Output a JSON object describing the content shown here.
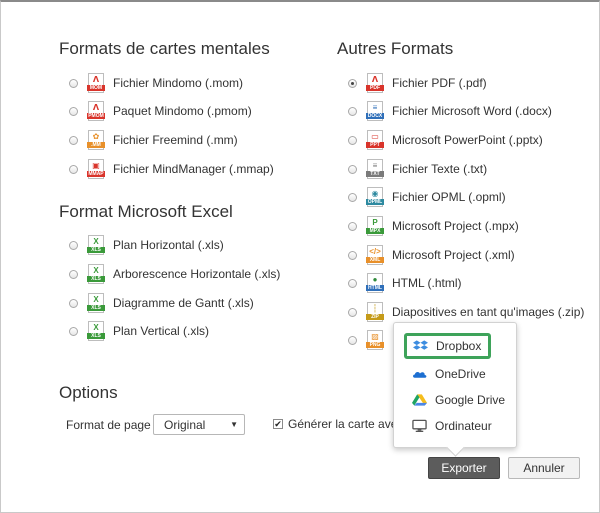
{
  "mind_map_formats": {
    "title": "Formats de cartes mentales",
    "items": [
      {
        "label": "Fichier Mindomo (.mom)",
        "tag": "MOM",
        "icon": "mindomo-file-icon"
      },
      {
        "label": "Paquet Mindomo (.pmom)",
        "tag": "PMOM",
        "icon": "mindomo-package-icon"
      },
      {
        "label": "Fichier Freemind (.mm)",
        "tag": ".MM",
        "icon": "freemind-file-icon"
      },
      {
        "label": "Fichier MindManager (.mmap)",
        "tag": "MMAP",
        "icon": "mindmanager-file-icon"
      }
    ]
  },
  "excel_formats": {
    "title": "Format Microsoft Excel",
    "items": [
      {
        "label": "Plan Horizontal (.xls)",
        "tag": "XLS",
        "icon": "excel-file-icon"
      },
      {
        "label": "Arborescence Horizontale (.xls)",
        "tag": "XLS",
        "icon": "excel-file-icon"
      },
      {
        "label": "Diagramme de Gantt (.xls)",
        "tag": "XLS",
        "icon": "excel-file-icon"
      },
      {
        "label": "Plan Vertical (.xls)",
        "tag": "XLS",
        "icon": "excel-file-icon"
      }
    ]
  },
  "other_formats": {
    "title": "Autres Formats",
    "selected_index": 0,
    "items": [
      {
        "label": "Fichier PDF (.pdf)",
        "tag": "PDF",
        "icon": "pdf-file-icon"
      },
      {
        "label": "Fichier Microsoft Word (.docx)",
        "tag": "DOCX",
        "icon": "word-file-icon"
      },
      {
        "label": "Microsoft PowerPoint (.pptx)",
        "tag": "PPT",
        "icon": "powerpoint-file-icon"
      },
      {
        "label": "Fichier Texte (.txt)",
        "tag": "TXT",
        "icon": "text-file-icon"
      },
      {
        "label": "Fichier OPML (.opml)",
        "tag": "OPML",
        "icon": "opml-file-icon"
      },
      {
        "label": "Microsoft Project (.mpx)",
        "tag": "MPX",
        "icon": "project-file-icon"
      },
      {
        "label": "Microsoft Project (.xml)",
        "tag": "XML",
        "icon": "xml-file-icon"
      },
      {
        "label": "HTML (.html)",
        "tag": "HTML",
        "icon": "html-file-icon"
      },
      {
        "label": "Diapositives en tant qu'images (.zip)",
        "tag": "ZIP",
        "icon": "zip-file-icon"
      },
      {
        "label": "",
        "tag": "PNG",
        "icon": "png-file-icon"
      }
    ]
  },
  "options": {
    "title": "Options",
    "page_format_label": "Format de page",
    "page_format_value": "Original",
    "generate_label": "Générer la carte avec",
    "generate_checked": true
  },
  "export_menu": {
    "items": [
      {
        "label": "Dropbox",
        "icon": "dropbox-icon"
      },
      {
        "label": "OneDrive",
        "icon": "onedrive-icon"
      },
      {
        "label": "Google Drive",
        "icon": "google-drive-icon"
      },
      {
        "label": "Ordinateur",
        "icon": "computer-icon"
      }
    ],
    "highlight_color": "#3ea35a"
  },
  "buttons": {
    "export": "Exporter",
    "cancel": "Annuler"
  }
}
